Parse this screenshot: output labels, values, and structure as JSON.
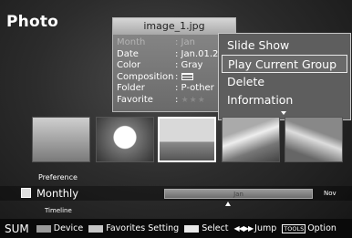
{
  "app": {
    "title": "Photo"
  },
  "info_panel": {
    "filename": "image_1.jpg",
    "rows": [
      {
        "key": "Month",
        "value": ": Jan",
        "dim": true
      },
      {
        "key": "Date",
        "value": ": Jan.01.2",
        "dim": false
      },
      {
        "key": "Color",
        "value": ": Gray",
        "dim": false
      },
      {
        "key": "Composition",
        "value": ":",
        "dim": false
      },
      {
        "key": "Folder",
        "value": ": P-other",
        "dim": false
      },
      {
        "key": "Favorite",
        "value": ":",
        "dim": false
      }
    ]
  },
  "menu": {
    "items": [
      {
        "label": "Slide Show"
      },
      {
        "label": "Play Current Group"
      },
      {
        "label": "Delete"
      },
      {
        "label": "Information"
      }
    ],
    "selected_index": 1
  },
  "thumbnails": {
    "count": 5,
    "selected_index": 2,
    "icons": [
      "animals-thumbnail",
      "flower-thumbnail",
      "landscape-thumbnail",
      "mountain-thumbnail",
      "scenery-thumbnail"
    ]
  },
  "timeline": {
    "preference_label": "Preference",
    "mode_label": "Monthly",
    "current_month": "Jan",
    "end_month": "Nov",
    "label": "Timeline"
  },
  "bottom_bar": {
    "sum": "SUM",
    "device": "Device",
    "favorites": "Favorites Setting",
    "select": "Select",
    "jump": "Jump",
    "tools": "TOOLS",
    "option": "Option"
  }
}
